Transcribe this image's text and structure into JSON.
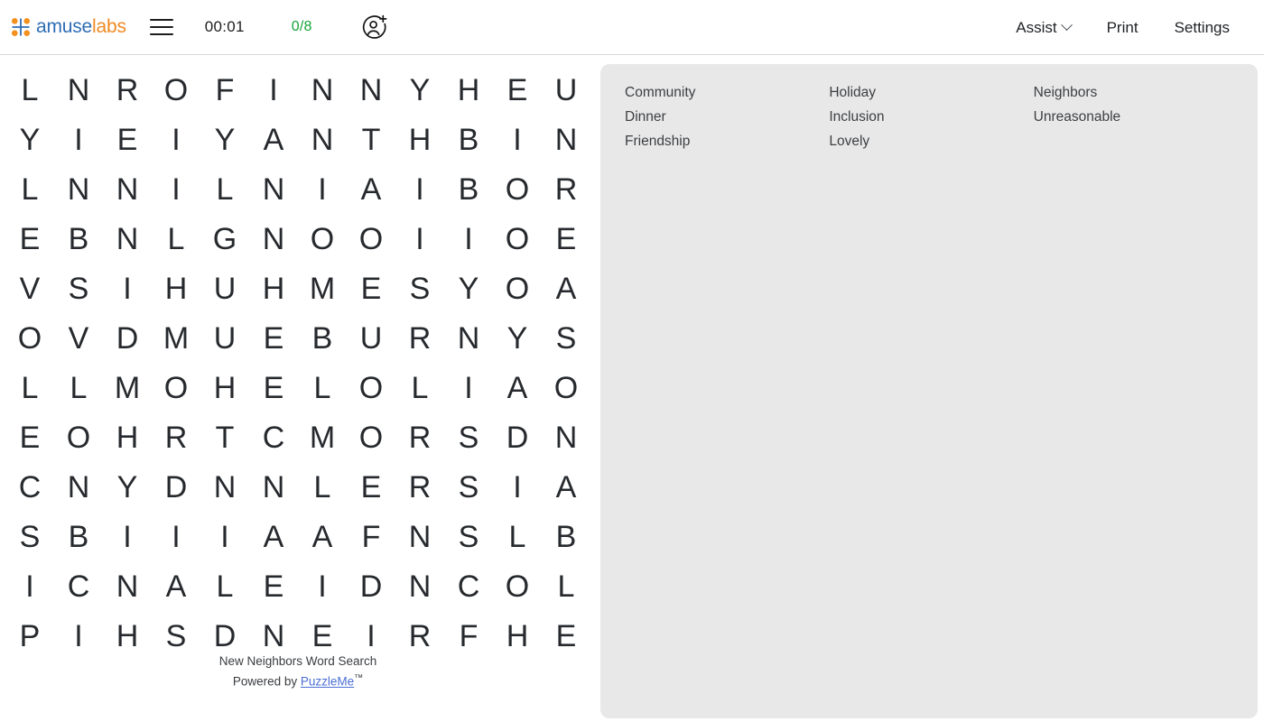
{
  "header": {
    "logo": {
      "name": "amuselabs",
      "part1": "amuse",
      "part2": "labs",
      "dot_color": "#f4901e",
      "cross_color": "#2e6db4"
    },
    "menu_icon": "hamburger-icon",
    "timer": "00:01",
    "progress": "0/8",
    "progress_color": "#16a336",
    "invite_icon": "person-add-icon",
    "assist_label": "Assist",
    "print_label": "Print",
    "settings_label": "Settings"
  },
  "grid": {
    "rows": 12,
    "cols": 12,
    "letters": [
      [
        "L",
        "N",
        "R",
        "O",
        "F",
        "I",
        "N",
        "N",
        "Y",
        "H",
        "E",
        "U"
      ],
      [
        "Y",
        "I",
        "E",
        "I",
        "Y",
        "A",
        "N",
        "T",
        "H",
        "B",
        "I",
        "N"
      ],
      [
        "L",
        "N",
        "N",
        "I",
        "L",
        "N",
        "I",
        "A",
        "I",
        "B",
        "O",
        "R"
      ],
      [
        "E",
        "B",
        "N",
        "L",
        "G",
        "N",
        "O",
        "O",
        "I",
        "I",
        "O",
        "E"
      ],
      [
        "V",
        "S",
        "I",
        "H",
        "U",
        "H",
        "M",
        "E",
        "S",
        "Y",
        "O",
        "A"
      ],
      [
        "O",
        "V",
        "D",
        "M",
        "U",
        "E",
        "B",
        "U",
        "R",
        "N",
        "Y",
        "S"
      ],
      [
        "L",
        "L",
        "M",
        "O",
        "H",
        "E",
        "L",
        "O",
        "L",
        "I",
        "A",
        "O"
      ],
      [
        "E",
        "O",
        "H",
        "R",
        "T",
        "C",
        "M",
        "O",
        "R",
        "S",
        "D",
        "N"
      ],
      [
        "C",
        "N",
        "Y",
        "D",
        "N",
        "N",
        "L",
        "E",
        "R",
        "S",
        "I",
        "A"
      ],
      [
        "S",
        "B",
        "I",
        "I",
        "I",
        "A",
        "A",
        "F",
        "N",
        "S",
        "L",
        "B"
      ],
      [
        "I",
        "C",
        "N",
        "A",
        "L",
        "E",
        "I",
        "D",
        "N",
        "C",
        "O",
        "L"
      ],
      [
        "P",
        "I",
        "H",
        "S",
        "D",
        "N",
        "E",
        "I",
        "R",
        "F",
        "H",
        "E"
      ]
    ]
  },
  "footer": {
    "title": "New Neighbors Word Search",
    "powered_prefix": "Powered by ",
    "link_label": "PuzzleMe",
    "trademark": "™"
  },
  "words": {
    "columns": [
      [
        "Community",
        "Dinner",
        "Friendship"
      ],
      [
        "Holiday",
        "Inclusion",
        "Lovely"
      ],
      [
        "Neighbors",
        "Unreasonable"
      ]
    ]
  }
}
